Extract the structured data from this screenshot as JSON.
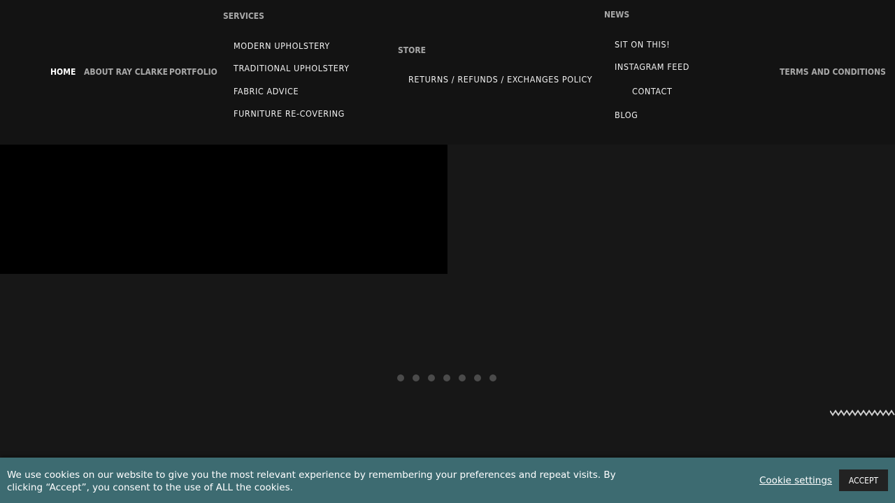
{
  "nav": {
    "home": "HOME",
    "about": "ABOUT RAY CLARKE",
    "portfolio": "PORTFOLIO",
    "services": {
      "label": "SERVICES",
      "items": [
        "MODERN UPHOLSTERY",
        "TRADITIONAL UPHOLSTERY",
        "FABRIC ADVICE",
        "FURNITURE RE-COVERING"
      ]
    },
    "store": {
      "label": "STORE",
      "items": [
        "RETURNS / REFUNDS / EXCHANGES POLICY"
      ]
    },
    "news": {
      "label": "NEWS",
      "items": [
        "SIT ON THIS!",
        "INSTAGRAM FEED"
      ]
    },
    "contact": "CONTACT",
    "blog": "BLOG",
    "terms": "TERMS AND CONDITIONS"
  },
  "slider": {
    "dot_count": 7,
    "dot_color": "#4b4b4b"
  },
  "cookie": {
    "message": "We use cookies on our website to give you the most relevant experience by remembering your preferences and repeat visits. By clicking “Accept”, you consent to the use of ALL the cookies.",
    "settings_label": "Cookie settings",
    "accept_label": "ACCEPT",
    "bar_color": "#3d6b71"
  },
  "colors": {
    "background": "#171717",
    "header": "#131313",
    "hero_media": "#000000"
  }
}
